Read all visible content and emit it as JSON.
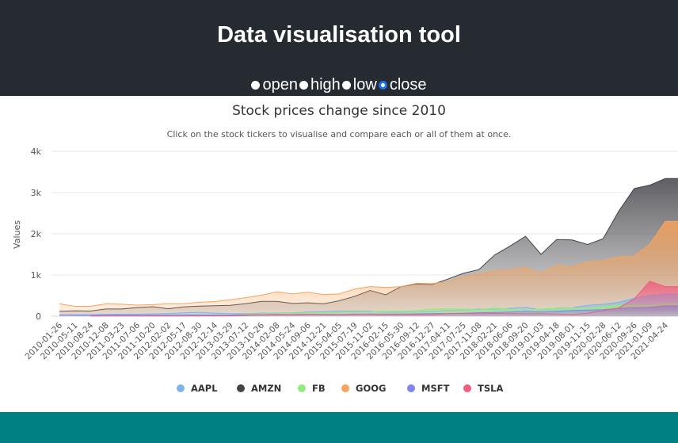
{
  "header": {
    "title": "Data visualisation tool",
    "radios": [
      {
        "label": "open",
        "checked": false
      },
      {
        "label": "high",
        "checked": false
      },
      {
        "label": "low",
        "checked": false
      },
      {
        "label": "close",
        "checked": true
      }
    ]
  },
  "chart_data": {
    "type": "area",
    "title": "Stock prices change since 2010",
    "subtitle": "Click on the stock tickers to visualise and compare each or all of them at once.",
    "ylabel": "Values",
    "xlabel": "",
    "ylim": [
      0,
      4000
    ],
    "yticks": [
      {
        "v": 0,
        "label": "0"
      },
      {
        "v": 1000,
        "label": "1k"
      },
      {
        "v": 2000,
        "label": "2k"
      },
      {
        "v": 3000,
        "label": "3k"
      },
      {
        "v": 4000,
        "label": "4k"
      }
    ],
    "grid": true,
    "legend": "bottom",
    "x": [
      "2010-01-26",
      "2010-05-11",
      "2010-08-24",
      "2010-12-08",
      "2011-03-23",
      "2011-07-06",
      "2011-10-20",
      "2012-02-02",
      "2012-05-17",
      "2012-08-30",
      "2012-12-14",
      "2013-03-29",
      "2013-07-12",
      "2013-10-26",
      "2014-02-08",
      "2014-05-24",
      "2014-09-06",
      "2014-12-21",
      "2015-04-05",
      "2015-07-19",
      "2015-11-02",
      "2016-02-15",
      "2016-05-30",
      "2016-09-12",
      "2016-12-27",
      "2017-04-11",
      "2017-07-25",
      "2017-11-08",
      "2018-02-21",
      "2018-06-06",
      "2018-09-20",
      "2019-01-03",
      "2019-04-18",
      "2019-08-01",
      "2019-11-15",
      "2020-02-28",
      "2020-06-12",
      "2020-09-26",
      "2021-01-09",
      "2021-04-24"
    ],
    "series": [
      {
        "name": "AMZN",
        "color": "#434348",
        "values": [
          120,
          130,
          125,
          175,
          175,
          210,
          230,
          180,
          225,
          245,
          255,
          265,
          305,
          360,
          360,
          310,
          325,
          300,
          375,
          480,
          625,
          520,
          720,
          780,
          770,
          900,
          1040,
          1130,
          1480,
          1700,
          1940,
          1500,
          1860,
          1850,
          1740,
          1880,
          2550,
          3100,
          3180,
          3340
        ]
      },
      {
        "name": "GOOG",
        "color": "#f7a35c",
        "values": [
          300,
          240,
          240,
          300,
          290,
          270,
          280,
          300,
          300,
          340,
          355,
          400,
          450,
          510,
          590,
          540,
          580,
          525,
          540,
          660,
          720,
          700,
          720,
          800,
          790,
          840,
          960,
          1030,
          1100,
          1130,
          1180,
          1050,
          1240,
          1200,
          1320,
          1350,
          1440,
          1460,
          1750,
          2300
        ]
      },
      {
        "name": "AAPL",
        "color": "#7cb5ec",
        "values": [
          30,
          35,
          35,
          45,
          50,
          50,
          55,
          65,
          80,
          95,
          75,
          60,
          60,
          75,
          75,
          85,
          100,
          110,
          125,
          125,
          120,
          95,
          100,
          115,
          115,
          145,
          150,
          175,
          170,
          190,
          220,
          150,
          200,
          205,
          265,
          290,
          340,
          440,
          510,
          540
        ]
      },
      {
        "name": "FB",
        "color": "#90ed7d",
        "values": [
          null,
          null,
          null,
          null,
          null,
          null,
          null,
          null,
          38,
          20,
          27,
          26,
          50,
          63,
          62,
          77,
          80,
          83,
          95,
          105,
          100,
          130,
          120,
          140,
          175,
          180,
          175,
          160,
          200,
          170,
          135,
          175,
          195,
          200,
          190,
          230,
          265,
          260,
          260,
          300
        ]
      },
      {
        "name": "MSFT",
        "color": "#8085e9",
        "values": [
          29,
          28,
          24,
          27,
          27,
          26,
          27,
          29,
          30,
          30,
          27,
          28,
          34,
          35,
          37,
          40,
          46,
          47,
          41,
          45,
          53,
          50,
          52,
          57,
          62,
          65,
          73,
          84,
          92,
          100,
          114,
          100,
          120,
          138,
          150,
          160,
          190,
          205,
          215,
          255
        ]
      },
      {
        "name": "TSLA",
        "color": "#f15c80",
        "values": [
          null,
          null,
          4,
          5,
          5,
          6,
          6,
          6,
          6,
          6,
          7,
          8,
          22,
          36,
          46,
          42,
          50,
          42,
          40,
          52,
          46,
          40,
          44,
          40,
          43,
          60,
          66,
          60,
          68,
          60,
          60,
          60,
          55,
          45,
          70,
          140,
          200,
          420,
          850,
          720
        ]
      }
    ],
    "legend_order": [
      "AAPL",
      "AMZN",
      "FB",
      "GOOG",
      "MSFT",
      "TSLA"
    ]
  }
}
